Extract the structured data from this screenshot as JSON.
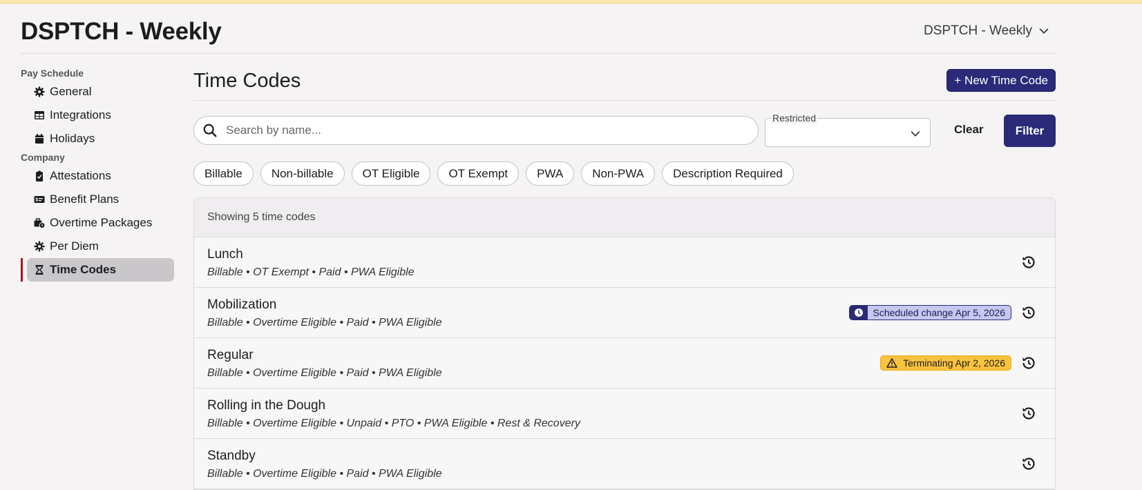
{
  "app": {
    "title": "DSPTCH - Weekly",
    "schedule_switcher": "DSPTCH - Weekly"
  },
  "sidebar": {
    "sections": [
      {
        "label": "Pay Schedule",
        "items": [
          {
            "label": "General",
            "icon": "gear-icon"
          },
          {
            "label": "Integrations",
            "icon": "table-icon"
          },
          {
            "label": "Holidays",
            "icon": "calendar-icon"
          }
        ]
      },
      {
        "label": "Company",
        "items": [
          {
            "label": "Attestations",
            "icon": "clipboard-check-icon"
          },
          {
            "label": "Benefit Plans",
            "icon": "money-check-icon"
          },
          {
            "label": "Overtime Packages",
            "icon": "briefcase-clock-icon"
          },
          {
            "label": "Per Diem",
            "icon": "gear-icon"
          },
          {
            "label": "Time Codes",
            "icon": "hourglass-icon",
            "active": true
          }
        ]
      }
    ]
  },
  "main": {
    "title": "Time Codes",
    "new_button": "+ New Time Code",
    "search": {
      "placeholder": "Search by name...",
      "value": ""
    },
    "restricted": {
      "label": "Restricted",
      "value": ""
    },
    "clear_label": "Clear",
    "filter_label": "Filter",
    "chips": [
      "Billable",
      "Non-billable",
      "OT Eligible",
      "OT Exempt",
      "PWA",
      "Non-PWA",
      "Description Required"
    ],
    "list": {
      "summary": "Showing 5 time codes",
      "rows": [
        {
          "name": "Lunch",
          "tags": "Billable • OT Exempt • Paid • PWA Eligible",
          "badge": ""
        },
        {
          "name": "Mobilization",
          "tags": "Billable • Overtime Eligible • Paid • PWA Eligible",
          "badge": "Scheduled change Apr 5, 2026",
          "badge_type": "scheduled"
        },
        {
          "name": "Regular",
          "tags": "Billable • Overtime Eligible • Paid • PWA Eligible",
          "badge": "Terminating Apr 2, 2026",
          "badge_type": "terminating"
        },
        {
          "name": "Rolling in the Dough",
          "tags": "Billable • Overtime Eligible • Unpaid • PTO • PWA Eligible • Rest & Recovery",
          "badge": ""
        },
        {
          "name": "Standby",
          "tags": "Billable • Overtime Eligible • Paid • PWA Eligible",
          "badge": ""
        }
      ]
    }
  },
  "colors": {
    "primary": "#2a2a78",
    "active_marker": "#a31622",
    "warning": "#fbc23f",
    "scheduled_bg": "#c6c8ee"
  }
}
